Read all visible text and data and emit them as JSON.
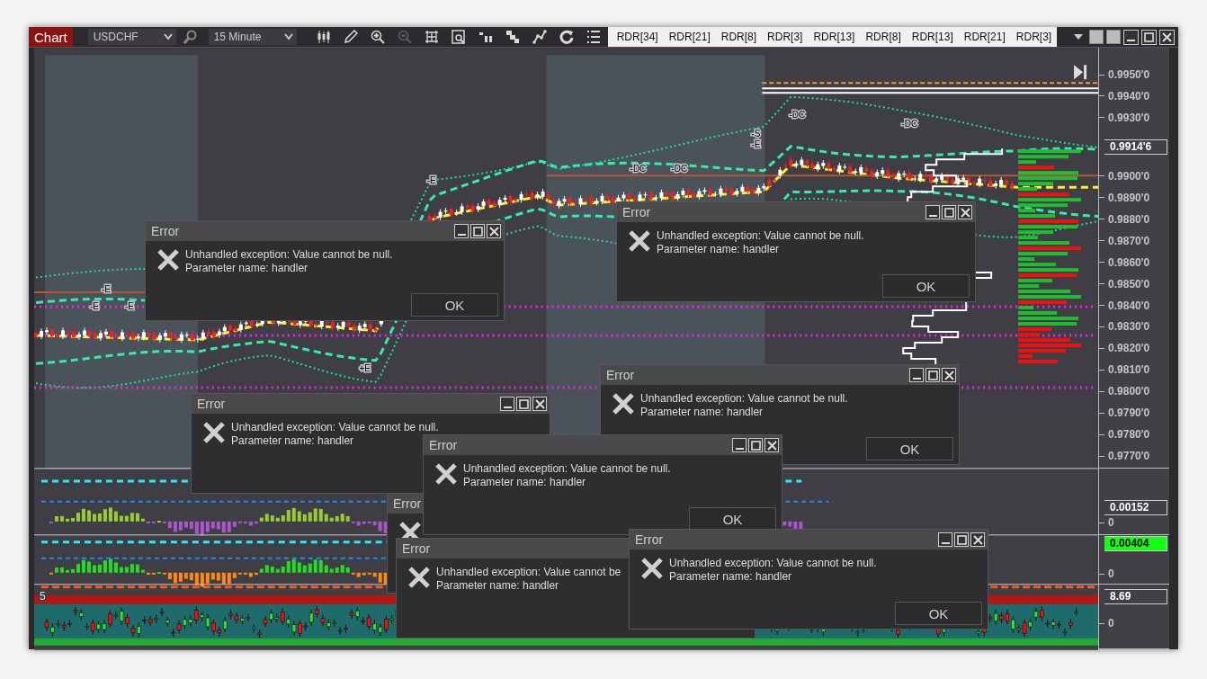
{
  "toolbar": {
    "chart_button": "Chart",
    "symbol": "USDCHF",
    "timeframe": "15 Minute",
    "tools": [
      {
        "kind": "candles",
        "disabled": false
      },
      {
        "kind": "pencil",
        "disabled": false
      },
      {
        "kind": "zoom-in",
        "disabled": false
      },
      {
        "kind": "zoom-out",
        "disabled": true
      },
      {
        "kind": "crosshair",
        "disabled": false
      },
      {
        "kind": "find",
        "disabled": false
      },
      {
        "kind": "bars",
        "disabled": false
      },
      {
        "kind": "steps",
        "disabled": false
      },
      {
        "kind": "nodes",
        "disabled": false
      },
      {
        "kind": "refresh",
        "disabled": false
      },
      {
        "kind": "list",
        "disabled": false
      }
    ]
  },
  "indicator_tabs": [
    "RDR[34]",
    "RDR[21]",
    "RDR[8]",
    "RDR[3]",
    "RDR[13]",
    "RDR[8]",
    "RDR[13]",
    "RDR[21]",
    "RDR[3]"
  ],
  "price_axis": {
    "labels_above": [
      "0.9950'0",
      "0.9940'0",
      "0.9930'0"
    ],
    "current_price": "0.9914'6",
    "labels_below": [
      "0.9900'0",
      "0.9890'0",
      "0.9880'0",
      "0.9870'0",
      "0.9860'0",
      "0.9850'0",
      "0.9840'0",
      "0.9830'0",
      "0.9820'0",
      "0.9810'0",
      "0.9800'0",
      "0.9790'0",
      "0.9780'0",
      "0.9770'0"
    ]
  },
  "signal_labels": [
    "-DC",
    "-DC",
    "-DC",
    "-DC",
    "-S",
    "-E",
    "-E",
    "-E",
    "-E",
    "-E",
    "+E"
  ],
  "panels": [
    {
      "marker": "0.00152",
      "highlighted": false,
      "zero": "0"
    },
    {
      "marker": "0.00404",
      "highlighted": true,
      "zero": "0"
    },
    {
      "label": "5",
      "marker": "8.69",
      "highlighted": false,
      "zero": "0"
    }
  ],
  "dialogs": [
    {
      "title": "Error",
      "message": "Unhandled exception: Value cannot be null.",
      "detail": "Parameter name: handler",
      "button": "OK"
    },
    {
      "title": "Error",
      "message": "Unhandled exception: Value cannot be null.",
      "detail": "Parameter name: handler",
      "button": "OK"
    },
    {
      "title": "Error",
      "message": "Unhandled exception: Value cannot be null.",
      "detail": "Parameter name: handler"
    },
    {
      "title": "Error",
      "message": "Unhandled exception: Value cannot be null.",
      "detail": "Parameter name: handler",
      "button": "OK"
    },
    {
      "title": "Error"
    },
    {
      "title": "Error",
      "message": "Unhandled exception: Value cannot be null.",
      "detail": "Parameter name: handler",
      "button": "OK"
    },
    {
      "title": "Error",
      "message": "Unhandled exception: Value cannot be",
      "detail": "Parameter name: handler"
    },
    {
      "title": "Error",
      "message": "Unhandled exception: Value cannot be null.",
      "detail": "Parameter name: handler",
      "button": "OK"
    }
  ]
}
